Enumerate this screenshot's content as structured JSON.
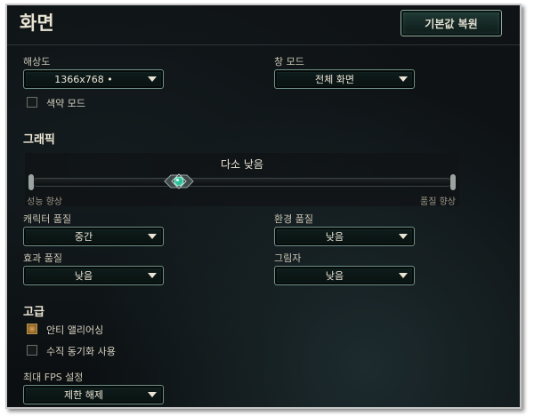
{
  "header": {
    "title": "화면",
    "reset_button": "기본값 복원"
  },
  "resolution": {
    "label": "해상도",
    "value": "1366x768 •"
  },
  "window_mode": {
    "label": "창 모드",
    "value": "전체 화면"
  },
  "colorblind": {
    "label": "색약 모드",
    "checked": false
  },
  "graphics": {
    "title": "그래픽",
    "slider": {
      "value_label": "다소 낮음",
      "min_label": "성능 향상",
      "max_label": "품질 향상",
      "level": 0.35
    },
    "character_quality": {
      "label": "캐릭터 품질",
      "value": "중간"
    },
    "environment_quality": {
      "label": "환경 품질",
      "value": "낮음"
    },
    "effects_quality": {
      "label": "효과 품질",
      "value": "낮음"
    },
    "shadows": {
      "label": "그림자",
      "value": "낮음"
    }
  },
  "advanced": {
    "title": "고급",
    "anti_aliasing": {
      "label": "안티 앨리어싱",
      "checked": true
    },
    "vsync": {
      "label": "수직 동기화 사용",
      "checked": false
    },
    "fps": {
      "label": "최대 FPS 설정",
      "value": "제한 해제"
    }
  },
  "colors": {
    "accent": "#2fbf9a",
    "gold": "#c8964a",
    "text": "#ece7d8"
  }
}
